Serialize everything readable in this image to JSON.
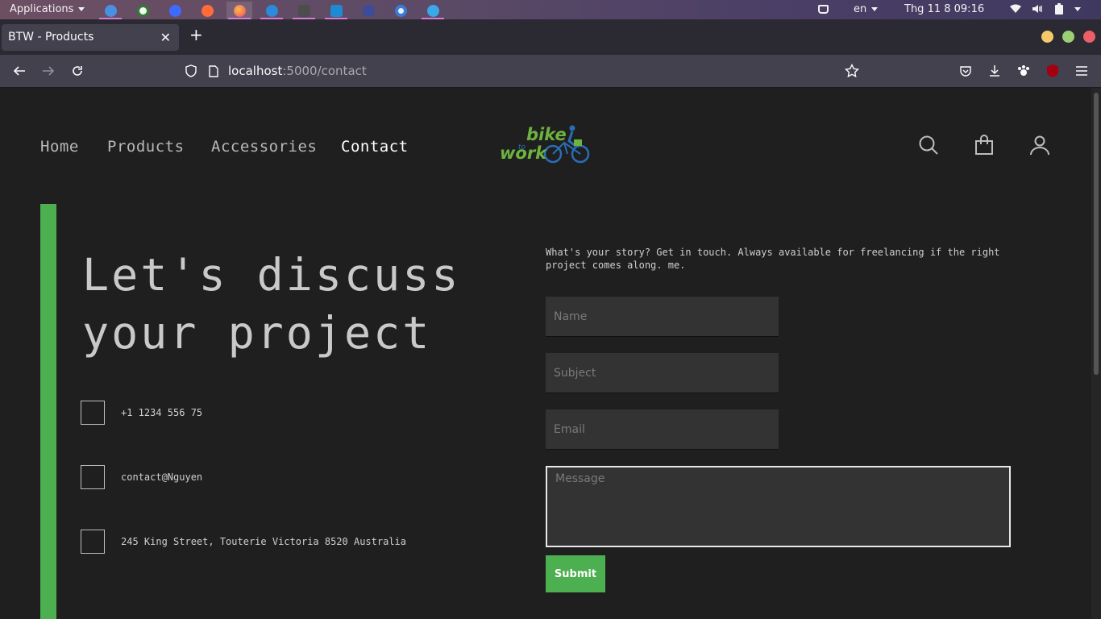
{
  "system_panel": {
    "applications_label": "Applications",
    "keyboard_lang": "en",
    "clock": "Thg 11 8  09:16",
    "taskbar_icons": [
      "files-icon",
      "chrome-icon",
      "app-icon",
      "postman-icon",
      "firefox-icon",
      "app-icon",
      "terminal-icon",
      "vscode-icon",
      "monitor-icon",
      "app-icon",
      "app-icon"
    ]
  },
  "browser": {
    "tab_title": "BTW - Products",
    "url_host": "localhost",
    "url_rest": ":5000/contact"
  },
  "nav": {
    "items": [
      "Home",
      "Products",
      "Accessories",
      "Contact"
    ],
    "active": "Contact"
  },
  "logo": {
    "line1": "bike",
    "line2": "to",
    "line3": "work"
  },
  "hero": {
    "line1": "Let's discuss",
    "line2": "your project"
  },
  "contact": {
    "phone": "+1 1234 556 75",
    "email": "contact@Nguyen",
    "address": "245 King Street, Touterie Victoria 8520 Australia"
  },
  "form": {
    "intro_line1": "What's your story? Get in touch. Always available for freelancing if the right",
    "intro_line2": "project comes along. me.",
    "name_placeholder": "Name",
    "subject_placeholder": "Subject",
    "email_placeholder": "Email",
    "message_placeholder": "Message",
    "submit_label": "Submit"
  },
  "colors": {
    "accent": "#4caf50",
    "background": "#1f1f1f",
    "field": "#333333"
  }
}
